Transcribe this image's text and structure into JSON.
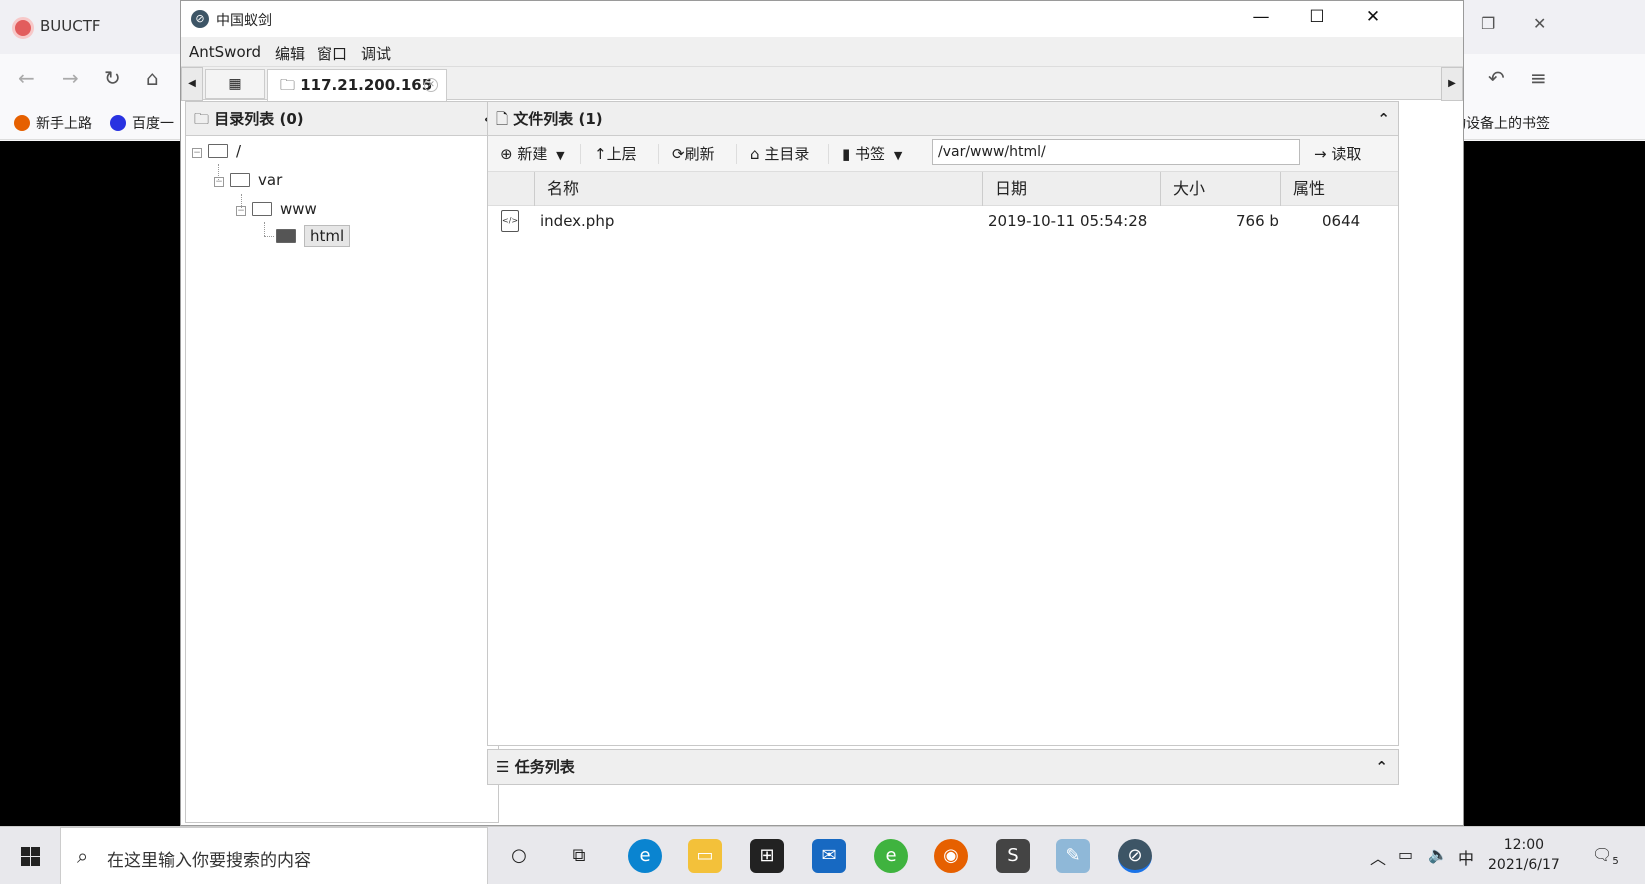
{
  "firefox": {
    "tab_title": "BUUCTF",
    "bookmarks": [
      "新手上路",
      "百度一"
    ],
    "mobile_bookmarks": "移动设备上的书签"
  },
  "window": {
    "title": "中国蚁剑",
    "menu": [
      "AntSword",
      "编辑",
      "窗口",
      "调试"
    ],
    "tab_host": "117.21.200.165"
  },
  "left_panel": {
    "title": "目录列表 (0)",
    "tree": [
      {
        "label": "/",
        "depth": 0
      },
      {
        "label": "var",
        "depth": 1
      },
      {
        "label": "www",
        "depth": 2
      },
      {
        "label": "html",
        "depth": 3
      }
    ]
  },
  "right_panel": {
    "title": "文件列表 (1)",
    "toolbar": {
      "new": "新建",
      "up": "上层",
      "refresh": "刷新",
      "home": "主目录",
      "bookmark": "书签",
      "path": "/var/www/html/",
      "read": "读取"
    },
    "columns": [
      "名称",
      "日期",
      "大小",
      "属性"
    ],
    "files": [
      {
        "name": "index.php",
        "date": "2019-10-11 05:54:28",
        "size": "766 b",
        "attr": "0644"
      }
    ]
  },
  "task_panel": {
    "title": "任务列表"
  },
  "taskbar": {
    "search_placeholder": "在这里输入你要搜索的内容",
    "ime": "中",
    "time": "12:00",
    "date": "2021/6/17",
    "notifications": "5"
  }
}
